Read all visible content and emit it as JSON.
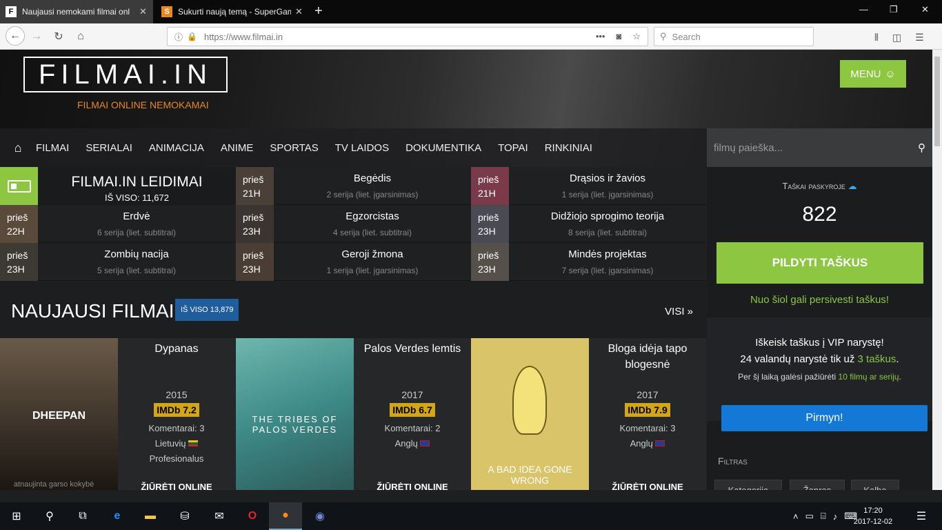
{
  "browser": {
    "tabs": [
      {
        "title": "Naujausi nemokami filmai onl",
        "favicon": "F"
      },
      {
        "title": "Sukurti naują temą - SuperGam",
        "favicon": "S"
      }
    ],
    "url": "https://www.filmai.in",
    "search_placeholder": "Search"
  },
  "site": {
    "logo": "FILMAI.IN",
    "tagline": "FILMAI ONLINE NEMOKAMAI",
    "menu_label": "MENU",
    "nav": [
      "FILMAI",
      "SERIALAI",
      "ANIMACIJA",
      "ANIME",
      "SPORTAS",
      "TV LAIDOS",
      "DOKUMENTIKA",
      "TOPAI",
      "RINKINIAI"
    ],
    "search_placeholder": "filmų paieška...",
    "releases": {
      "title": "FILMAI.IN LEIDIMAI",
      "total": "IŠ VISO: 11,672",
      "items": [
        {
          "ago": "prieš",
          "time": "21H",
          "name": "Begėdis",
          "sub": "2 serija (liet. įgarsinimas)"
        },
        {
          "ago": "prieš",
          "time": "21H",
          "name": "Drąsios ir žavios",
          "sub": "1 serija (liet. įgarsinimas)"
        },
        {
          "ago": "prieš",
          "time": "22H",
          "name": "Erdvė",
          "sub": "6 serija (liet. subtitrai)"
        },
        {
          "ago": "prieš",
          "time": "23H",
          "name": "Egzorcistas",
          "sub": "4 serija (liet. subtitrai)"
        },
        {
          "ago": "prieš",
          "time": "23H",
          "name": "Didžiojo sprogimo teorija",
          "sub": "8 serija (liet. subtitrai)"
        },
        {
          "ago": "prieš",
          "time": "23H",
          "name": "Zombių nacija",
          "sub": "5 serija (liet. subtitrai)"
        },
        {
          "ago": "prieš",
          "time": "23H",
          "name": "Geroji žmona",
          "sub": "1 serija (liet. įgarsinimas)"
        },
        {
          "ago": "prieš",
          "time": "23H",
          "name": "Mindės projektas",
          "sub": "7 serija (liet. įgarsinimas)"
        }
      ]
    },
    "newest": {
      "title": "NAUJAUSI FILMAI",
      "badge": "IŠ VISO 13,879",
      "all": "VISI »"
    },
    "movies": [
      {
        "title": "Dypanas",
        "year": "2015",
        "imdb": "IMDb 7.2",
        "comments": "Komentarai: 3",
        "lang": "Lietuvių",
        "extra": "Profesionalus",
        "poster_text": "DHEEPAN",
        "poster_note": "atnaujinta garso kokybė",
        "watch": "ŽIŪRĖTI ONLINE"
      },
      {
        "title": "Palos Verdes lemtis",
        "year": "2017",
        "imdb": "IMDb 6.7",
        "comments": "Komentarai: 2",
        "lang": "Anglų",
        "extra": "",
        "poster_text": "THE TRIBES OF PALOS VERDES",
        "poster_note": "",
        "watch": "ŽIŪRĖTI ONLINE"
      },
      {
        "title": "Bloga idėja tapo blogesnė",
        "year": "2017",
        "imdb": "IMDb 7.9",
        "comments": "Komentarai: 3",
        "lang": "Anglų",
        "extra": "",
        "poster_text": "A BAD IDEA GONE WRONG",
        "poster_note": "",
        "watch": "ŽIŪRĖTI ONLINE"
      }
    ],
    "points": {
      "label": "Taškai paskyroje",
      "value": "822",
      "fill": "PILDYTI TAŠKUS",
      "can": "Nuo šiol gali persivesti taškus!"
    },
    "vip": {
      "line1": "Iškeisk taškus į VIP narystę!",
      "line2a": "24 valandų narystė tik už ",
      "line2b": "3 taškus",
      "line2c": ".",
      "line3a": "Per šį laiką galėsi pažiūrėti ",
      "line3b": "10 filmų ar serijų",
      "line3c": ".",
      "go": "Pirmyn!"
    },
    "filter": {
      "title": "Filtras",
      "buttons": [
        "Kategorija",
        "Žanras",
        "Kalba"
      ]
    }
  },
  "taskbar": {
    "time": "17:20",
    "date": "2017-12-02"
  },
  "colors": {
    "accent": "#8dc640",
    "orange": "#e8891f",
    "imdb": "#d2a617",
    "blue": "#1479d6"
  }
}
